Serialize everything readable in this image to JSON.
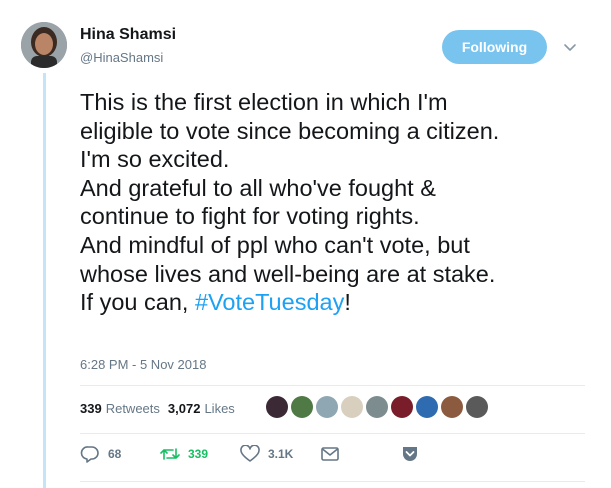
{
  "user": {
    "name": "Hina Shamsi",
    "handle": "@HinaShamsi"
  },
  "follow_button": {
    "label": "Following"
  },
  "tweet": {
    "lines": [
      "This is the first election in which I'm",
      "eligible to vote since becoming a citizen.",
      "I'm so excited.",
      "And grateful to all who've fought &",
      "continue to fight for voting rights.",
      "And mindful of ppl who can't vote, but",
      "whose lives and well-being are at stake."
    ],
    "last_line_prefix": "If you can, ",
    "hashtag": "#VoteTuesday",
    "last_line_suffix": "!",
    "timestamp": "6:28 PM - 5 Nov 2018"
  },
  "stats": {
    "retweets_count": "339",
    "retweets_label": "Retweets",
    "likes_count": "3,072",
    "likes_label": "Likes"
  },
  "liker_avatars": [
    {
      "color": "#3b2a36"
    },
    {
      "color": "#4f7a45"
    },
    {
      "color": "#8fa6b3"
    },
    {
      "color": "#d8cfbf"
    },
    {
      "color": "#7d8c8e"
    },
    {
      "color": "#7a1d2a"
    },
    {
      "color": "#2f6bb0"
    },
    {
      "color": "#8c5b3f"
    },
    {
      "color": "#5a5a5a"
    }
  ],
  "actions": {
    "reply_count": "68",
    "retweet_count": "339",
    "like_count": "3.1K"
  },
  "colors": {
    "accent": "#1da1f2",
    "follow_bg": "#79c3ef",
    "retweet_green": "#17bf63",
    "muted": "#657786"
  }
}
